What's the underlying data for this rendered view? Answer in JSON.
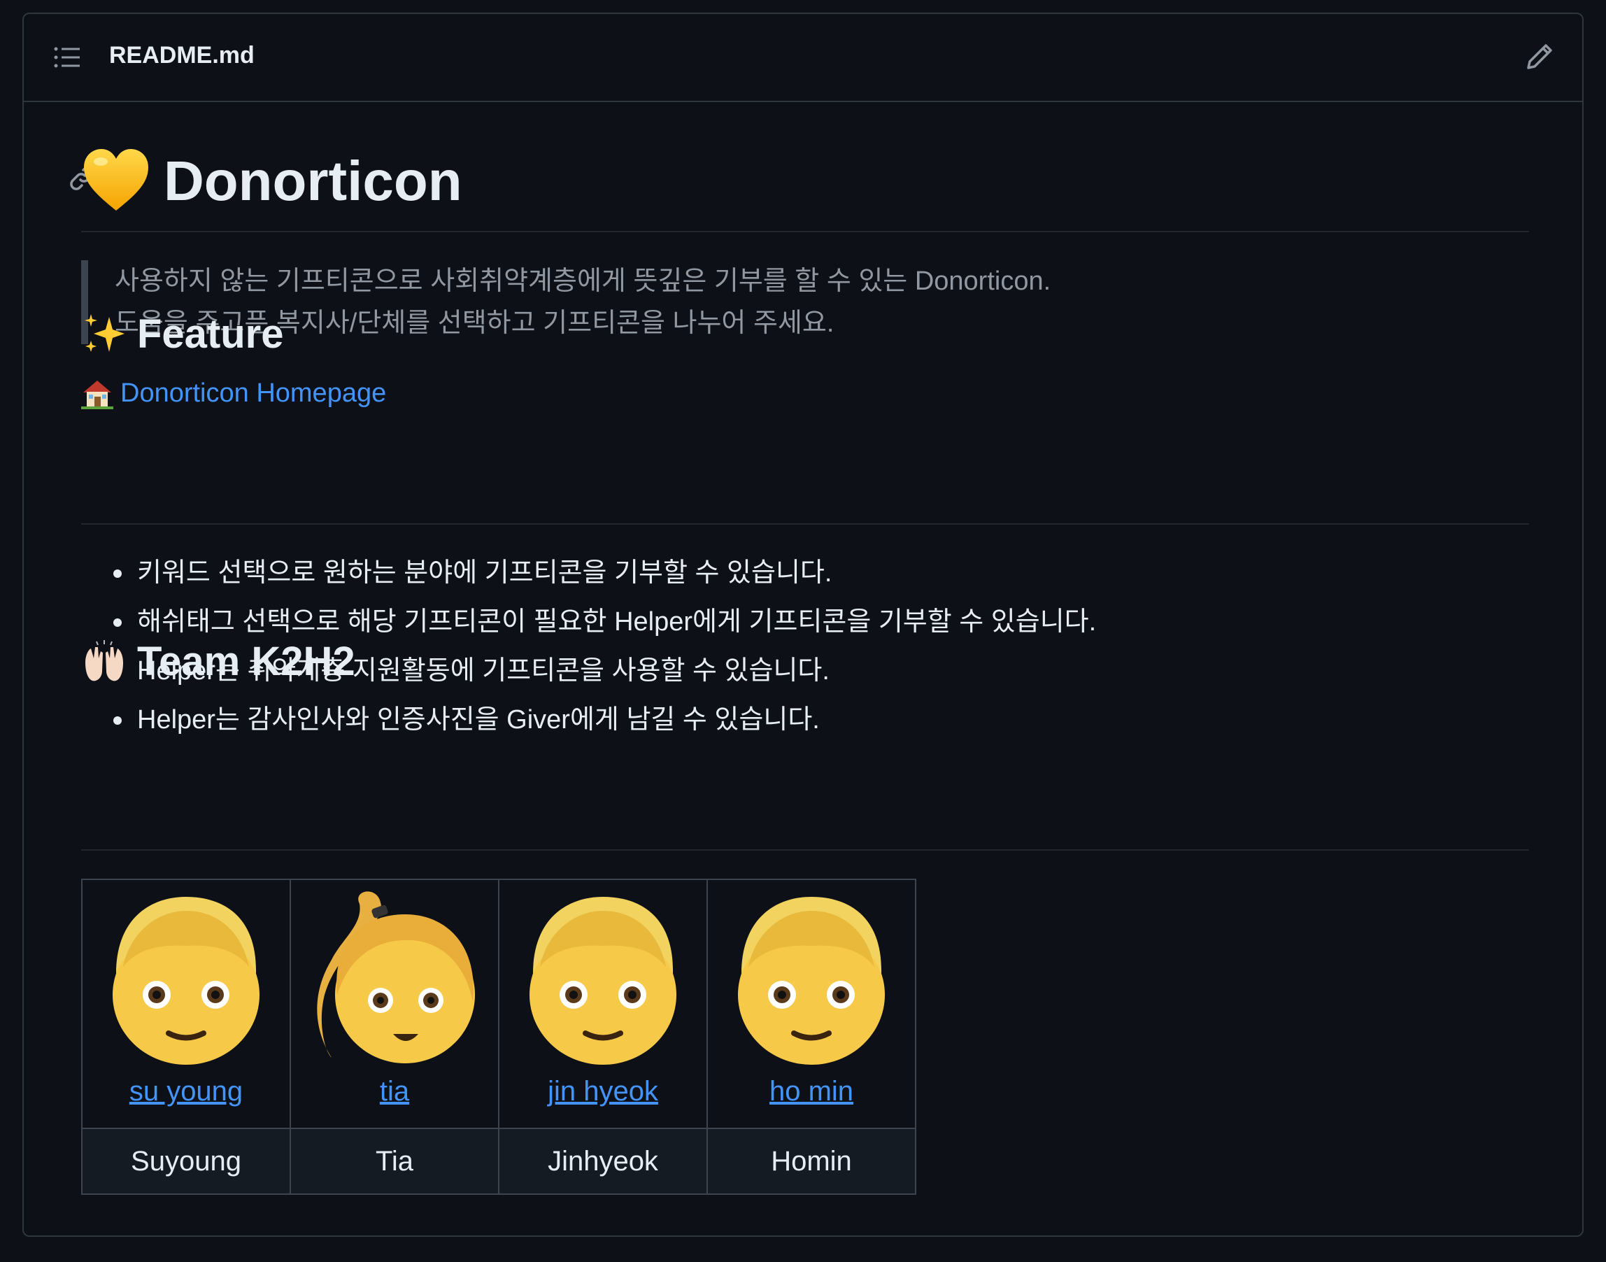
{
  "file": {
    "name": "README.md"
  },
  "readme": {
    "title": "Donorticon",
    "quote_lines": [
      "사용하지 않는 기프티콘으로 사회취약계층에게 뜻깊은 기부를 할 수 있는 Donorticon.",
      "도움을 주고픈 복지사/단체를 선택하고 기프티콘을 나누어 주세요."
    ],
    "homepage_link": "Donorticon Homepage",
    "feature_heading": "Feature",
    "features": [
      "키워드 선택으로 원하는 분야에 기프티콘을 기부할 수 있습니다.",
      "해쉬태그 선택으로 해당 기프티콘이 필요한 Helper에게 기프티콘을 기부할 수 있습니다.",
      "Helper는 취약계층 지원활동에 기프티콘을 사용할 수 있습니다.",
      "Helper는 감사인사와 인증사진을 Giver에게 남길 수 있습니다."
    ],
    "team_heading": "Team K2H2",
    "team": [
      {
        "link": "su young",
        "name": "Suyoung",
        "avatar": "man-emoji"
      },
      {
        "link": "tia",
        "name": "Tia",
        "avatar": "woman-ponytail-emoji"
      },
      {
        "link": "jin hyeok",
        "name": "Jinhyeok",
        "avatar": "man-emoji"
      },
      {
        "link": "ho min",
        "name": "Homin",
        "avatar": "man-emoji"
      }
    ]
  },
  "icons": {
    "outline": "list-outline-icon",
    "edit": "pencil-icon",
    "anchor": "link-icon",
    "title_emoji": "yellow-heart-icon",
    "homepage_emoji": "house-icon",
    "feature_emoji": "sparkles-icon",
    "team_emoji": "raising-hands-icon"
  },
  "colors": {
    "background": "#0d1117",
    "border": "#30363d",
    "text": "#e6edf3",
    "muted": "#9198a1",
    "link": "#4493f8"
  }
}
